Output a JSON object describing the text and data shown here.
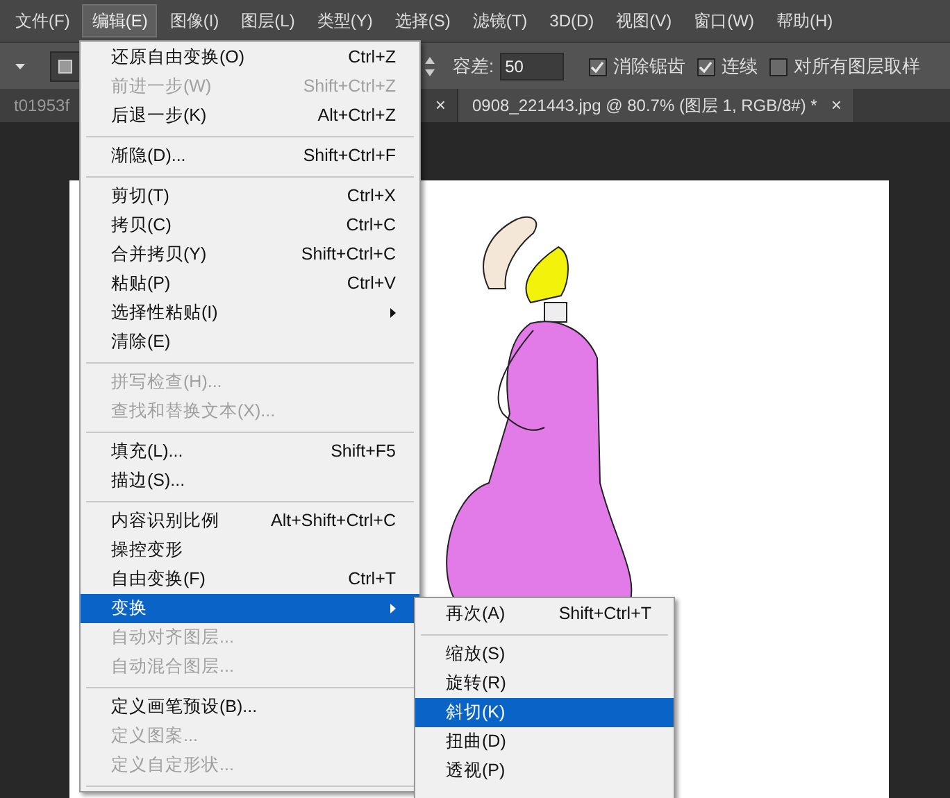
{
  "menubar": [
    {
      "label": "文件(F)",
      "selected": false
    },
    {
      "label": "编辑(E)",
      "selected": true
    },
    {
      "label": "图像(I)",
      "selected": false
    },
    {
      "label": "图层(L)",
      "selected": false
    },
    {
      "label": "类型(Y)",
      "selected": false
    },
    {
      "label": "选择(S)",
      "selected": false
    },
    {
      "label": "滤镜(T)",
      "selected": false
    },
    {
      "label": "3D(D)",
      "selected": false
    },
    {
      "label": "视图(V)",
      "selected": false
    },
    {
      "label": "窗口(W)",
      "selected": false
    },
    {
      "label": "帮助(H)",
      "selected": false
    }
  ],
  "options_bar": {
    "tolerance_label": "容差:",
    "tolerance_value": "50",
    "checkboxes": [
      {
        "label": "消除锯齿",
        "checked": true
      },
      {
        "label": "连续",
        "checked": true
      },
      {
        "label": "对所有图层取样",
        "checked": false
      }
    ]
  },
  "tabs": [
    {
      "label": "t01953f",
      "selected": false,
      "close": "×"
    },
    {
      "label": "0908_221443.jpg @ 80.7% (图层 1, RGB/8#) *",
      "selected": true,
      "close": "×"
    }
  ],
  "edit_menu": [
    {
      "kind": "item",
      "label": "还原自由变换(O)",
      "shortcut": "Ctrl+Z",
      "disabled": false,
      "selected": false,
      "has_submenu": false
    },
    {
      "kind": "item",
      "label": "前进一步(W)",
      "shortcut": "Shift+Ctrl+Z",
      "disabled": true,
      "selected": false,
      "has_submenu": false
    },
    {
      "kind": "item",
      "label": "后退一步(K)",
      "shortcut": "Alt+Ctrl+Z",
      "disabled": false,
      "selected": false,
      "has_submenu": false
    },
    {
      "kind": "separator"
    },
    {
      "kind": "item",
      "label": "渐隐(D)...",
      "shortcut": "Shift+Ctrl+F",
      "disabled": false,
      "selected": false,
      "has_submenu": false
    },
    {
      "kind": "separator"
    },
    {
      "kind": "item",
      "label": "剪切(T)",
      "shortcut": "Ctrl+X",
      "disabled": false,
      "selected": false,
      "has_submenu": false
    },
    {
      "kind": "item",
      "label": "拷贝(C)",
      "shortcut": "Ctrl+C",
      "disabled": false,
      "selected": false,
      "has_submenu": false
    },
    {
      "kind": "item",
      "label": "合并拷贝(Y)",
      "shortcut": "Shift+Ctrl+C",
      "disabled": false,
      "selected": false,
      "has_submenu": false
    },
    {
      "kind": "item",
      "label": "粘贴(P)",
      "shortcut": "Ctrl+V",
      "disabled": false,
      "selected": false,
      "has_submenu": false
    },
    {
      "kind": "item",
      "label": "选择性粘贴(I)",
      "disabled": false,
      "selected": false,
      "has_submenu": true
    },
    {
      "kind": "item",
      "label": "清除(E)",
      "disabled": false,
      "selected": false,
      "has_submenu": false
    },
    {
      "kind": "separator"
    },
    {
      "kind": "item",
      "label": "拼写检查(H)...",
      "disabled": true,
      "selected": false,
      "has_submenu": false
    },
    {
      "kind": "item",
      "label": "查找和替换文本(X)...",
      "disabled": true,
      "selected": false,
      "has_submenu": false
    },
    {
      "kind": "separator"
    },
    {
      "kind": "item",
      "label": "填充(L)...",
      "shortcut": "Shift+F5",
      "disabled": false,
      "selected": false,
      "has_submenu": false
    },
    {
      "kind": "item",
      "label": "描边(S)...",
      "disabled": false,
      "selected": false,
      "has_submenu": false
    },
    {
      "kind": "separator"
    },
    {
      "kind": "item",
      "label": "内容识别比例",
      "shortcut": "Alt+Shift+Ctrl+C",
      "disabled": false,
      "selected": false,
      "has_submenu": false
    },
    {
      "kind": "item",
      "label": "操控变形",
      "disabled": false,
      "selected": false,
      "has_submenu": false
    },
    {
      "kind": "item",
      "label": "自由变换(F)",
      "shortcut": "Ctrl+T",
      "disabled": false,
      "selected": false,
      "has_submenu": false
    },
    {
      "kind": "item",
      "label": "变换",
      "disabled": false,
      "selected": true,
      "has_submenu": true
    },
    {
      "kind": "item",
      "label": "自动对齐图层...",
      "disabled": true,
      "selected": false,
      "has_submenu": false
    },
    {
      "kind": "item",
      "label": "自动混合图层...",
      "disabled": true,
      "selected": false,
      "has_submenu": false
    },
    {
      "kind": "separator"
    },
    {
      "kind": "item",
      "label": "定义画笔预设(B)...",
      "disabled": false,
      "selected": false,
      "has_submenu": false
    },
    {
      "kind": "item",
      "label": "定义图案...",
      "disabled": true,
      "selected": false,
      "has_submenu": false
    },
    {
      "kind": "item",
      "label": "定义自定形状...",
      "disabled": true,
      "selected": false,
      "has_submenu": false
    },
    {
      "kind": "separator"
    }
  ],
  "transform_submenu": [
    {
      "kind": "item",
      "label": "再次(A)",
      "shortcut": "Shift+Ctrl+T",
      "selected": false
    },
    {
      "kind": "separator"
    },
    {
      "kind": "item",
      "label": "缩放(S)",
      "selected": false
    },
    {
      "kind": "item",
      "label": "旋转(R)",
      "selected": false
    },
    {
      "kind": "item",
      "label": "斜切(K)",
      "selected": true
    },
    {
      "kind": "item",
      "label": "扭曲(D)",
      "selected": false
    },
    {
      "kind": "item",
      "label": "透视(P)",
      "selected": false
    }
  ]
}
